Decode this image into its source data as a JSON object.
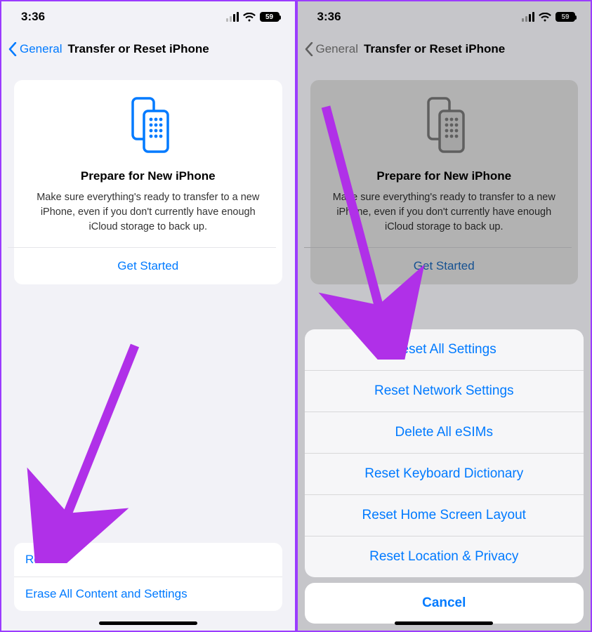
{
  "status": {
    "time": "3:36",
    "battery": "59"
  },
  "nav": {
    "back": "General",
    "title": "Transfer or Reset iPhone"
  },
  "card": {
    "heading": "Prepare for New iPhone",
    "body": "Make sure everything's ready to transfer to a new iPhone, even if you don't currently have enough iCloud storage to back up.",
    "action": "Get Started"
  },
  "bottom": {
    "reset": "Reset",
    "erase": "Erase All Content and Settings"
  },
  "sheet": {
    "items": [
      "Reset All Settings",
      "Reset Network Settings",
      "Delete All eSIMs",
      "Reset Keyboard Dictionary",
      "Reset Home Screen Layout",
      "Reset Location & Privacy"
    ],
    "cancel": "Cancel"
  },
  "colors": {
    "accent": "#007aff",
    "arrow": "#b030e8"
  }
}
